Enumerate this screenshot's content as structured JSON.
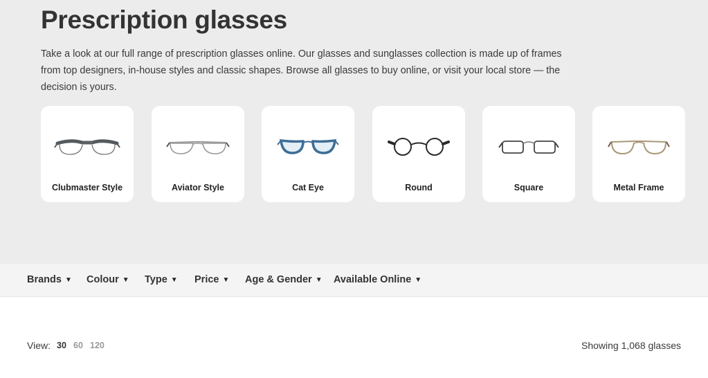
{
  "page": {
    "title": "Prescription glasses",
    "intro": "Take a look at our full range of prescription glasses online. Our glasses and sunglasses collection is made up of frames from top designers, in-house styles and classic shapes. Browse all glasses to buy online, or visit your local store — the decision is yours."
  },
  "categories": [
    {
      "label": "Clubmaster Style",
      "icon": "clubmaster-glasses",
      "frame_color": "#555a5e"
    },
    {
      "label": "Aviator Style",
      "icon": "aviator-glasses",
      "frame_color": "#9a9a9a"
    },
    {
      "label": "Cat Eye",
      "icon": "cat-eye-glasses",
      "frame_color": "#3d6e96"
    },
    {
      "label": "Round",
      "icon": "round-glasses",
      "frame_color": "#2a2a2a"
    },
    {
      "label": "Square",
      "icon": "square-glasses",
      "frame_color": "#444444"
    },
    {
      "label": "Metal Frame",
      "icon": "metal-frame-glasses",
      "frame_color": "#a89878"
    }
  ],
  "filters": [
    {
      "label": "Brands"
    },
    {
      "label": "Colour"
    },
    {
      "label": "Type"
    },
    {
      "label": "Price"
    },
    {
      "label": "Age & Gender"
    },
    {
      "label": "Available Online"
    }
  ],
  "results": {
    "view_label": "View:",
    "view_options": [
      "30",
      "60",
      "120"
    ],
    "selected_view": "30",
    "showing_text": "Showing 1,068 glasses"
  }
}
